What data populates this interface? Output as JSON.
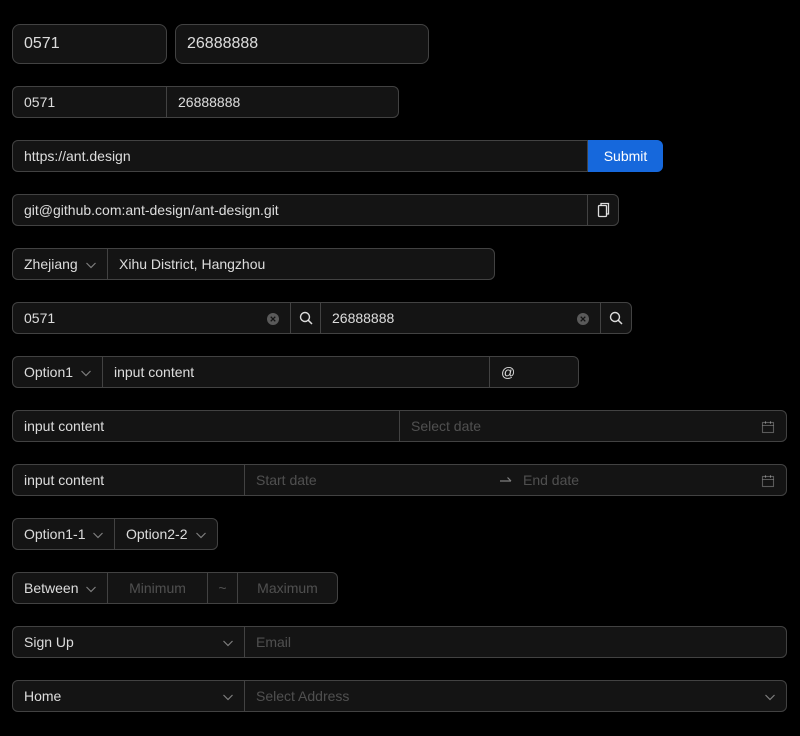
{
  "row1": {
    "area": "0571",
    "number": "26888888"
  },
  "row2": {
    "area": "0571",
    "number": "26888888"
  },
  "row3": {
    "url": "https://ant.design",
    "submit_label": "Submit"
  },
  "row4": {
    "git": "git@github.com:ant-design/ant-design.git"
  },
  "row5": {
    "province": "Zhejiang",
    "address": "Xihu District, Hangzhou"
  },
  "row6": {
    "area": "0571",
    "number": "26888888"
  },
  "row7": {
    "option": "Option1",
    "content": "input content",
    "suffix": "@"
  },
  "row8": {
    "content": "input content",
    "date_placeholder": "Select date"
  },
  "row9": {
    "content": "input content",
    "start_placeholder": "Start date",
    "end_placeholder": "End date"
  },
  "row10": {
    "option1": "Option1-1",
    "option2": "Option2-2"
  },
  "row11": {
    "mode": "Between",
    "min_placeholder": "Minimum",
    "separator": "~",
    "max_placeholder": "Maximum"
  },
  "row12": {
    "select": "Sign Up",
    "email_placeholder": "Email"
  },
  "row13": {
    "select": "Home",
    "address_placeholder": "Select Address"
  },
  "colors": {
    "primary": "#1668dc",
    "border": "#424242",
    "field_bg": "#141414",
    "page_bg": "#000000"
  },
  "icons": [
    "chevron-down-icon",
    "clear-icon",
    "search-icon",
    "copy-icon",
    "calendar-icon",
    "swap-arrow-icon"
  ]
}
